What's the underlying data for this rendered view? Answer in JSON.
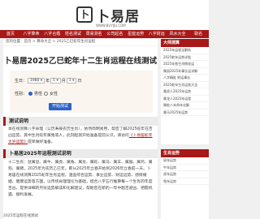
{
  "header": {
    "logo_char": "卜",
    "logo_name": "卜易居",
    "logo_url": "WWW.BUYIJU.COM"
  },
  "nav": [
    "首页",
    "八字算命",
    "八字合婚",
    "姓名测试",
    "周易测名",
    "公司起名",
    "星座运势",
    "八字财运",
    "风水大全",
    "取名"
  ],
  "breadcrumb": "您的位置：首页 > 算命大全 > 2025乙巳蛇年生肖运程",
  "article": {
    "title": "卜易居2025乙巳蛇年十二生肖运程在线测试",
    "form": {
      "birth_label": "生日：",
      "year": "1980",
      "year_unit": "年",
      "month": "1",
      "month_unit": "月",
      "day": "1",
      "day_unit": "日",
      "gender_label": "性别：",
      "male": "男性",
      "female": "女性",
      "submit": "开始测试"
    },
    "desc_heading": "测试说明",
    "desc_text": "本在线测算八字命理（公历寿辰农历生肖），依然简明易用，帮您了解2025蛇年在吉凶运势，其中生肖蛇年属兔等人，此刻起就开始准备提前认识，请访问",
    "desc_link": "《卜易居蛇年太岁运势》",
    "desc_tail": "提早做好准备。",
    "intro_heading": "卜易居2025年运程测试说明",
    "intro_text": "十二生肖：鼠属鼠、属牛、属虎、属兔、属龙、属蛇、属马、属羊、属猴、属鸡、属狗、属猪，2025年为农历乙巳年，即从2025年立春开始到2026年立春前一天。卜易居在线测算2025蛇年生肖运程，涵盖综合运势、事业运势、财运运势、感情婚姻、健康运势等方面，以传统命理理论为基础，结合八字五行推算每一个生肖的年度吉凶，提供详细的月份运势解读和化解建议，帮助您在新的一年中趋吉避凶、把握机遇、顺利发展。"
  },
  "sidebar": {
    "box1_title": "大师测算",
    "box1_items": [
      "2025年运程全解析",
      "2025蛇年运势详批",
      "2025年各生肖桃花运",
      "属鼠2025年事业运详解",
      "八字精批 财运事业",
      "2025蛇年生肖运势大全",
      "属虎人2025年运势",
      "属龙人2025年运程",
      "属蛇人本命年化解",
      "属马2025年运势"
    ],
    "box2_title": "生肖运势",
    "box2_items": [
      "鼠年运势",
      "牛年运势",
      "虎年运势",
      "兔年运势"
    ]
  },
  "footer": {
    "text": "2025年运程在线测试"
  }
}
